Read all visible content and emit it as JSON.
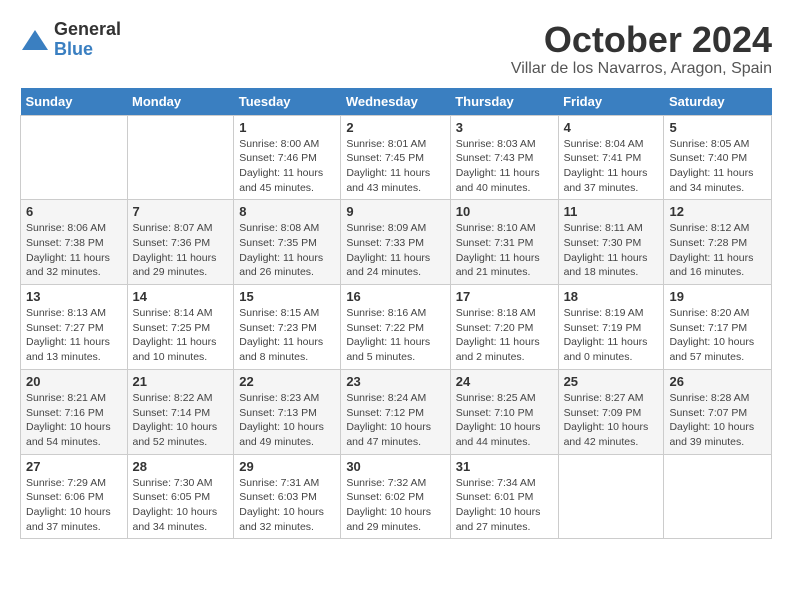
{
  "logo": {
    "general": "General",
    "blue": "Blue"
  },
  "title": "October 2024",
  "location": "Villar de los Navarros, Aragon, Spain",
  "weekdays": [
    "Sunday",
    "Monday",
    "Tuesday",
    "Wednesday",
    "Thursday",
    "Friday",
    "Saturday"
  ],
  "weeks": [
    [
      {
        "day": "",
        "detail": ""
      },
      {
        "day": "",
        "detail": ""
      },
      {
        "day": "1",
        "detail": "Sunrise: 8:00 AM\nSunset: 7:46 PM\nDaylight: 11 hours and 45 minutes."
      },
      {
        "day": "2",
        "detail": "Sunrise: 8:01 AM\nSunset: 7:45 PM\nDaylight: 11 hours and 43 minutes."
      },
      {
        "day": "3",
        "detail": "Sunrise: 8:03 AM\nSunset: 7:43 PM\nDaylight: 11 hours and 40 minutes."
      },
      {
        "day": "4",
        "detail": "Sunrise: 8:04 AM\nSunset: 7:41 PM\nDaylight: 11 hours and 37 minutes."
      },
      {
        "day": "5",
        "detail": "Sunrise: 8:05 AM\nSunset: 7:40 PM\nDaylight: 11 hours and 34 minutes."
      }
    ],
    [
      {
        "day": "6",
        "detail": "Sunrise: 8:06 AM\nSunset: 7:38 PM\nDaylight: 11 hours and 32 minutes."
      },
      {
        "day": "7",
        "detail": "Sunrise: 8:07 AM\nSunset: 7:36 PM\nDaylight: 11 hours and 29 minutes."
      },
      {
        "day": "8",
        "detail": "Sunrise: 8:08 AM\nSunset: 7:35 PM\nDaylight: 11 hours and 26 minutes."
      },
      {
        "day": "9",
        "detail": "Sunrise: 8:09 AM\nSunset: 7:33 PM\nDaylight: 11 hours and 24 minutes."
      },
      {
        "day": "10",
        "detail": "Sunrise: 8:10 AM\nSunset: 7:31 PM\nDaylight: 11 hours and 21 minutes."
      },
      {
        "day": "11",
        "detail": "Sunrise: 8:11 AM\nSunset: 7:30 PM\nDaylight: 11 hours and 18 minutes."
      },
      {
        "day": "12",
        "detail": "Sunrise: 8:12 AM\nSunset: 7:28 PM\nDaylight: 11 hours and 16 minutes."
      }
    ],
    [
      {
        "day": "13",
        "detail": "Sunrise: 8:13 AM\nSunset: 7:27 PM\nDaylight: 11 hours and 13 minutes."
      },
      {
        "day": "14",
        "detail": "Sunrise: 8:14 AM\nSunset: 7:25 PM\nDaylight: 11 hours and 10 minutes."
      },
      {
        "day": "15",
        "detail": "Sunrise: 8:15 AM\nSunset: 7:23 PM\nDaylight: 11 hours and 8 minutes."
      },
      {
        "day": "16",
        "detail": "Sunrise: 8:16 AM\nSunset: 7:22 PM\nDaylight: 11 hours and 5 minutes."
      },
      {
        "day": "17",
        "detail": "Sunrise: 8:18 AM\nSunset: 7:20 PM\nDaylight: 11 hours and 2 minutes."
      },
      {
        "day": "18",
        "detail": "Sunrise: 8:19 AM\nSunset: 7:19 PM\nDaylight: 11 hours and 0 minutes."
      },
      {
        "day": "19",
        "detail": "Sunrise: 8:20 AM\nSunset: 7:17 PM\nDaylight: 10 hours and 57 minutes."
      }
    ],
    [
      {
        "day": "20",
        "detail": "Sunrise: 8:21 AM\nSunset: 7:16 PM\nDaylight: 10 hours and 54 minutes."
      },
      {
        "day": "21",
        "detail": "Sunrise: 8:22 AM\nSunset: 7:14 PM\nDaylight: 10 hours and 52 minutes."
      },
      {
        "day": "22",
        "detail": "Sunrise: 8:23 AM\nSunset: 7:13 PM\nDaylight: 10 hours and 49 minutes."
      },
      {
        "day": "23",
        "detail": "Sunrise: 8:24 AM\nSunset: 7:12 PM\nDaylight: 10 hours and 47 minutes."
      },
      {
        "day": "24",
        "detail": "Sunrise: 8:25 AM\nSunset: 7:10 PM\nDaylight: 10 hours and 44 minutes."
      },
      {
        "day": "25",
        "detail": "Sunrise: 8:27 AM\nSunset: 7:09 PM\nDaylight: 10 hours and 42 minutes."
      },
      {
        "day": "26",
        "detail": "Sunrise: 8:28 AM\nSunset: 7:07 PM\nDaylight: 10 hours and 39 minutes."
      }
    ],
    [
      {
        "day": "27",
        "detail": "Sunrise: 7:29 AM\nSunset: 6:06 PM\nDaylight: 10 hours and 37 minutes."
      },
      {
        "day": "28",
        "detail": "Sunrise: 7:30 AM\nSunset: 6:05 PM\nDaylight: 10 hours and 34 minutes."
      },
      {
        "day": "29",
        "detail": "Sunrise: 7:31 AM\nSunset: 6:03 PM\nDaylight: 10 hours and 32 minutes."
      },
      {
        "day": "30",
        "detail": "Sunrise: 7:32 AM\nSunset: 6:02 PM\nDaylight: 10 hours and 29 minutes."
      },
      {
        "day": "31",
        "detail": "Sunrise: 7:34 AM\nSunset: 6:01 PM\nDaylight: 10 hours and 27 minutes."
      },
      {
        "day": "",
        "detail": ""
      },
      {
        "day": "",
        "detail": ""
      }
    ]
  ]
}
